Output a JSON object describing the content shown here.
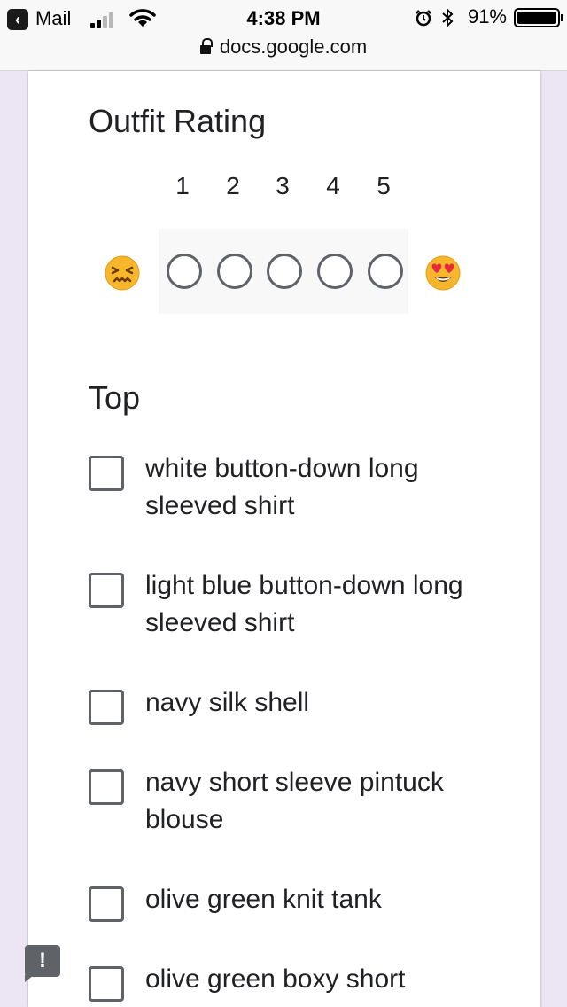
{
  "status_bar": {
    "back_app": "Mail",
    "time": "4:38 PM",
    "battery_percent": "91%",
    "battery_level": 0.91,
    "signal_bars_active": 2,
    "url": "docs.google.com"
  },
  "question": {
    "title": "Outfit Rating",
    "scale": [
      "1",
      "2",
      "3",
      "4",
      "5"
    ],
    "low_emoji": "confounded-face-emoji",
    "high_emoji": "heart-eyes-emoji"
  },
  "section": {
    "title": "Top",
    "options": [
      {
        "label": "white button-down long sleeved shirt",
        "checked": false
      },
      {
        "label": "light blue button-down long sleeved shirt",
        "checked": false
      },
      {
        "label": "navy silk shell",
        "checked": false
      },
      {
        "label": "navy short sleeve pintuck blouse",
        "checked": false
      },
      {
        "label": "olive green knit tank",
        "checked": false
      },
      {
        "label": "olive green boxy short",
        "checked": false
      }
    ]
  },
  "feedback": {
    "label": "!"
  }
}
